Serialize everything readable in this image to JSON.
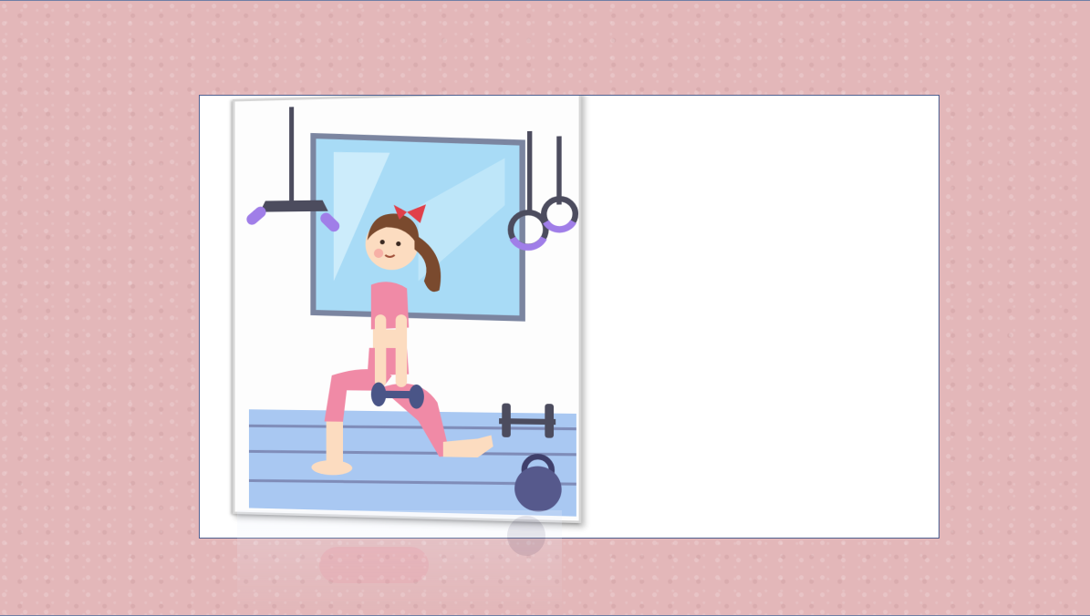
{
  "slide": {
    "illustration": {
      "subject": "woman-lunging-with-dumbbells-icon",
      "colors": {
        "outfit": "#f08aa6",
        "hair": "#7a4a2e",
        "bow": "#e0404a",
        "equipment": "#4c4c5e",
        "accent": "#a07ee8",
        "floor": "#a9c8f2",
        "window": "#a8dbf6"
      }
    }
  }
}
